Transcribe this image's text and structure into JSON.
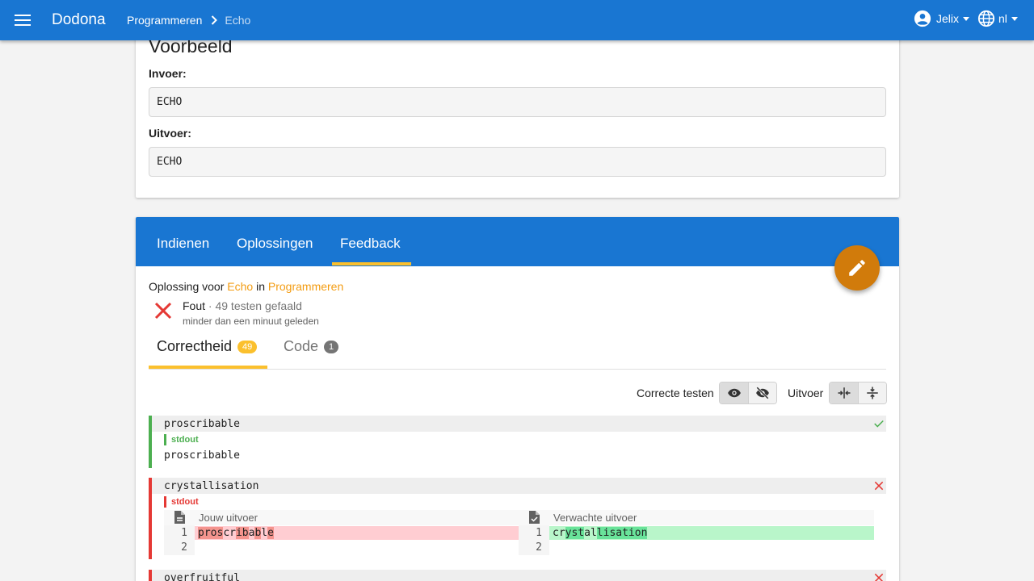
{
  "app": {
    "brand": "Dodona",
    "breadcrumb": [
      "Programmeren",
      "Echo"
    ],
    "user": "Jelix",
    "language": "nl"
  },
  "example": {
    "title": "Voorbeeld",
    "input_label": "Invoer:",
    "input_value": "ECHO",
    "output_label": "Uitvoer:",
    "output_value": "ECHO"
  },
  "tabs": [
    "Indienen",
    "Oplossingen",
    "Feedback"
  ],
  "active_tab": "Feedback",
  "submission": {
    "prefix": "Oplossing voor",
    "exercise": "Echo",
    "in": "in",
    "course": "Programmeren",
    "status": "Fout",
    "separator": "·",
    "detail": "49 testen gefaald",
    "time": "minder dan een minuut geleden"
  },
  "subtabs": [
    {
      "label": "Correctheid",
      "badge": "49"
    },
    {
      "label": "Code",
      "badge": "1"
    }
  ],
  "toolbar": {
    "correct_tests_label": "Correcte testen",
    "output_label": "Uitvoer"
  },
  "tests": [
    {
      "input": "proscribable",
      "channel": "stdout",
      "output": "proscribable",
      "status": "correct"
    },
    {
      "input": "crystallisation",
      "channel": "stdout",
      "status": "wrong",
      "your_output_label": "Jouw uitvoer",
      "expected_output_label": "Verwachte uitvoer",
      "line_numbers": [
        "1",
        "2"
      ],
      "your_output": "proscribable",
      "expected_output": "crystallisation"
    },
    {
      "input": "overfruitful",
      "status": "wrong"
    }
  ],
  "colors": {
    "primary": "#1976d2",
    "accent": "#fbc02d",
    "link": "#f39c12",
    "fab": "#d17b0b",
    "success": "#4caf50",
    "error": "#e53935"
  }
}
